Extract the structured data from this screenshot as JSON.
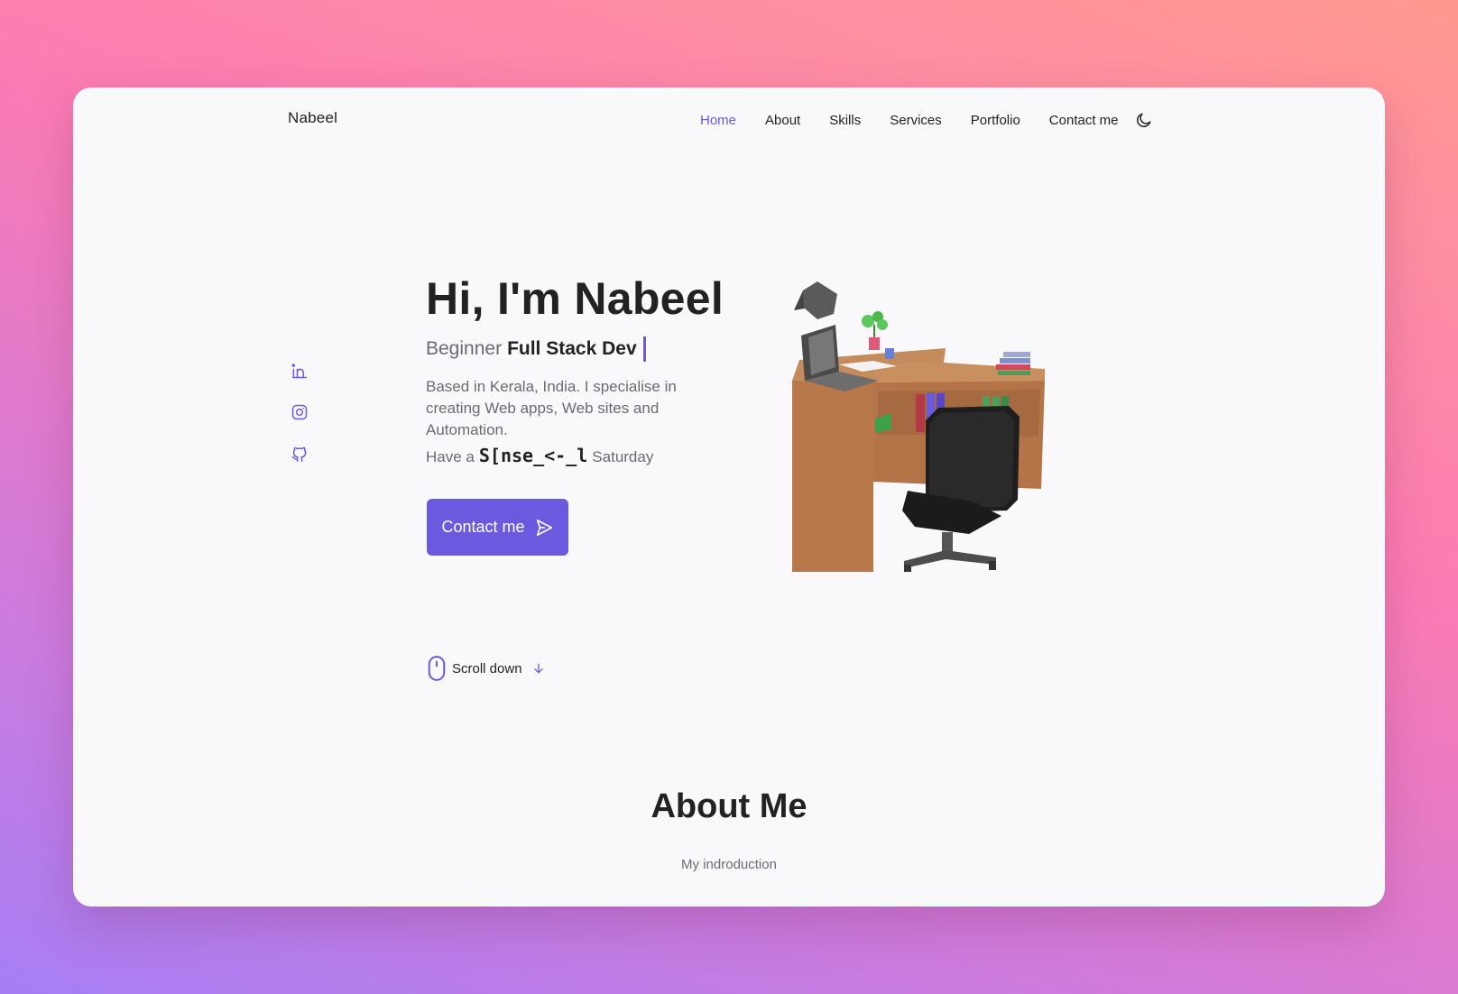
{
  "nav": {
    "logo": "Nabeel",
    "links": [
      "Home",
      "About",
      "Skills",
      "Services",
      "Portfolio",
      "Contact me"
    ],
    "active": "Home",
    "theme_icon": "moon-icon"
  },
  "socials": [
    "linkedin-icon",
    "instagram-icon",
    "github-icon"
  ],
  "hero": {
    "title": "Hi, I'm Nabeel",
    "subtitle_prefix": "Beginner",
    "subtitle_strong": "Full Stack Dev",
    "description": "Based in Kerala, India. I specialise in creating Web apps, Web sites and Automation.",
    "greet_prefix": "Have a",
    "greet_word": "S[nse_<-_l",
    "greet_day": "Saturday",
    "button_label": "Contact me",
    "button_icon": "send-icon",
    "illustration": "desk-workspace-illustration"
  },
  "scroll": {
    "label": "Scroll down",
    "icon": "mouse-icon",
    "arrow_icon": "arrow-down-icon"
  },
  "about": {
    "title": "About Me",
    "subtitle": "My indroduction"
  },
  "colors": {
    "accent": "#6b5ae0",
    "card_bg": "#f9f9fb",
    "text": "#222222",
    "muted": "#6a6a75"
  }
}
